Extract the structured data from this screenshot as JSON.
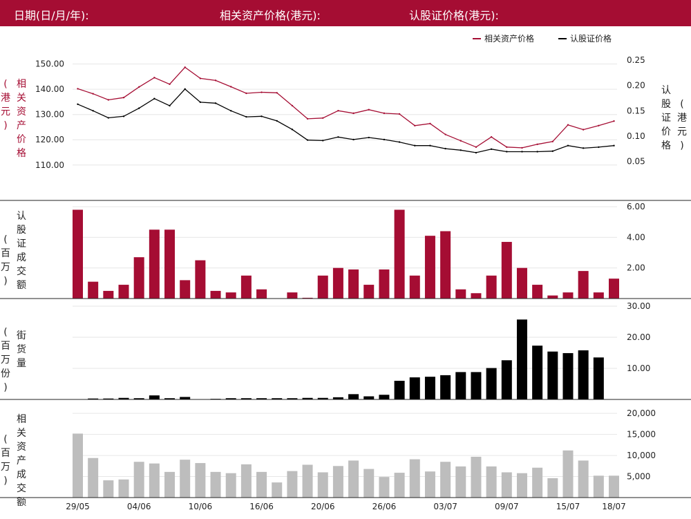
{
  "header": {
    "date_label": "日期(日/月/年):",
    "asset_price_label": "相关资产价格(港元):",
    "warrant_price_label": "认股证价格(港元):"
  },
  "colors": {
    "brand": "#a50d33",
    "warrant_line": "#000000",
    "asset_volume_bar": "#bdbdbd",
    "grid": "#e6e6e6"
  },
  "chart_data": [
    {
      "type": "line",
      "legend": [
        "相关资产价格",
        "认股证价格"
      ],
      "legend_position": "top-right",
      "left_axis_label": [
        "相",
        "关",
        "资",
        "产",
        "价",
        "格"
      ],
      "left_axis_unit": [
        "(",
        "港",
        "元",
        ")"
      ],
      "right_axis_label": [
        "认",
        "股",
        "证",
        "价",
        "格"
      ],
      "right_axis_unit": [
        "(",
        "港",
        "元",
        ")"
      ],
      "y_left_ticks": [
        "110.00",
        "120.00",
        "130.00",
        "140.00",
        "150.00"
      ],
      "y_right_ticks": [
        "0.05",
        "0.10",
        "0.15",
        "0.20",
        "0.25"
      ],
      "y_left_range": [
        102,
        154
      ],
      "y_right_range": [
        0.0026,
        0.2626
      ],
      "series": [
        {
          "name": "相关资产价格",
          "axis": "left",
          "values": [
            140.2,
            138.2,
            135.8,
            136.7,
            140.9,
            144.6,
            142.0,
            148.7,
            144.3,
            143.5,
            141.0,
            138.4,
            138.8,
            138.6,
            133.5,
            128.3,
            128.6,
            131.5,
            130.5,
            131.9,
            130.5,
            130.2,
            125.6,
            126.4,
            122.1,
            119.6,
            117.1,
            121.1,
            117.1,
            116.8,
            118.2,
            119.3,
            125.9,
            124.0,
            125.6,
            127.4
          ]
        },
        {
          "name": "认股证价格",
          "axis": "right",
          "values": [
            0.163,
            0.15,
            0.136,
            0.139,
            0.155,
            0.174,
            0.16,
            0.193,
            0.167,
            0.165,
            0.15,
            0.138,
            0.139,
            0.13,
            0.113,
            0.092,
            0.091,
            0.098,
            0.093,
            0.097,
            0.093,
            0.088,
            0.081,
            0.081,
            0.075,
            0.072,
            0.067,
            0.074,
            0.069,
            0.069,
            0.069,
            0.07,
            0.081,
            0.076,
            0.078,
            0.081
          ]
        }
      ]
    },
    {
      "type": "bar",
      "label": [
        "认",
        "股",
        "证",
        "成",
        "交",
        "额"
      ],
      "unit": [
        "(",
        "百",
        "万",
        ")"
      ],
      "y_ticks": [
        "2.00",
        "4.00",
        "6.00"
      ],
      "y_range": [
        0,
        6.5
      ],
      "values": [
        5.8,
        1.1,
        0.5,
        0.9,
        2.7,
        4.5,
        4.5,
        1.2,
        2.5,
        0.5,
        0.4,
        1.5,
        0.6,
        0,
        0.4,
        0.05,
        1.5,
        2.0,
        1.9,
        0.9,
        1.9,
        5.8,
        1.5,
        4.1,
        4.4,
        0.6,
        0.35,
        1.5,
        3.7,
        2.0,
        0.9,
        0.2,
        0.4,
        1.8,
        0.4,
        1.3
      ]
    },
    {
      "type": "bar",
      "label": [
        "街",
        "货",
        "量"
      ],
      "unit": [
        "(",
        "百",
        "万",
        "份",
        ")"
      ],
      "y_ticks": [
        "10.00",
        "20.00",
        "30.00"
      ],
      "y_range": [
        0,
        32
      ],
      "values": [
        0,
        0.3,
        0.3,
        0.5,
        0.4,
        1.3,
        0.4,
        0.8,
        0,
        0.2,
        0.4,
        0.4,
        0.4,
        0.4,
        0.4,
        0.5,
        0.5,
        0.7,
        1.7,
        1.0,
        1.5,
        6.0,
        7.1,
        7.3,
        7.8,
        8.8,
        8.8,
        10.1,
        12.6,
        25.7,
        17.3,
        15.4,
        14.9,
        15.8,
        13.5,
        0
      ]
    },
    {
      "type": "bar",
      "label": [
        "相",
        "关",
        "资",
        "产",
        "成",
        "交",
        "额"
      ],
      "unit": [
        "(",
        "百",
        "万",
        ")"
      ],
      "y_ticks": [
        "5,000",
        "10,000",
        "15,000",
        "20,000"
      ],
      "y_range": [
        0,
        22000
      ],
      "x_tick_labels": [
        "29/05",
        "04/06",
        "10/06",
        "16/06",
        "20/06",
        "26/06",
        "03/07",
        "09/07",
        "15/07",
        "18/07"
      ],
      "x_tick_index": [
        0,
        4,
        8,
        12,
        16,
        20,
        24,
        28,
        32,
        35
      ],
      "values": [
        15200,
        9400,
        4100,
        4300,
        8500,
        8100,
        6100,
        9000,
        8200,
        6100,
        5800,
        7900,
        6100,
        3600,
        6300,
        7800,
        6000,
        7500,
        8800,
        6800,
        4900,
        5900,
        9100,
        6200,
        8500,
        7400,
        9700,
        7400,
        6000,
        5800,
        7100,
        4600,
        11200,
        8800,
        5200,
        5200
      ]
    }
  ]
}
